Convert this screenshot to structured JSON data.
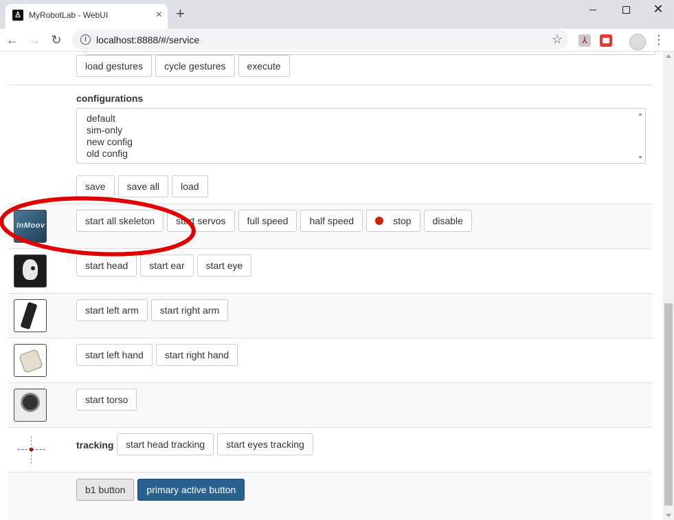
{
  "browser": {
    "tab_title": "MyRobotLab - WebUI",
    "tab_favicon": "robot-favicon-icon",
    "new_tab": "+",
    "close_tab": "×",
    "url": "localhost:8888/#/service",
    "window_controls": {
      "close": "✕"
    },
    "nav_icons": {
      "back": "←",
      "forward": "→",
      "reload": "↻",
      "star": "☆",
      "menu": "⋮",
      "info": "i"
    }
  },
  "gestures": {
    "buttons": [
      "load gestures",
      "cycle gestures",
      "execute"
    ]
  },
  "configurations": {
    "label": "configurations",
    "items": [
      "default",
      "sim-only",
      "new config",
      "old config"
    ],
    "buttons": [
      "save",
      "save all",
      "load"
    ]
  },
  "skeleton": {
    "thumbnail_text": "InMoov",
    "buttons": [
      "start all skeleton",
      "start servos",
      "full speed",
      "half speed",
      "stop",
      "disable"
    ]
  },
  "head": {
    "buttons": [
      "start head",
      "start ear",
      "start eye"
    ]
  },
  "arms": {
    "buttons": [
      "start left arm",
      "start right arm"
    ]
  },
  "hands": {
    "buttons": [
      "start left hand",
      "start right hand"
    ]
  },
  "torso": {
    "buttons": [
      "start torso"
    ]
  },
  "tracking": {
    "label": "tracking",
    "buttons": [
      "start head tracking",
      "start eyes tracking"
    ]
  },
  "footer": {
    "buttons": [
      "b1 button",
      "primary active button"
    ]
  },
  "colors": {
    "primary_button": "#286090",
    "annotation_ellipse": "#e00000",
    "stop_indicator": "#cc2200"
  }
}
